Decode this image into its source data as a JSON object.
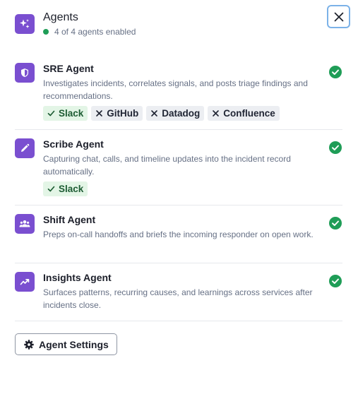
{
  "header": {
    "title": "Agents",
    "status": "4 of 4 agents enabled",
    "icon": "sparkles-icon"
  },
  "colors": {
    "accent": "#7a4fd0",
    "enabled_green": "#1f9d57",
    "tag_on_bg": "#e3f5e6",
    "tag_off_bg": "#eceef2",
    "focus_ring": "#7cb2e8"
  },
  "agents": [
    {
      "name": "SRE Agent",
      "icon": "shield-icon",
      "description": "Investigates incidents, correlates signals, and posts triage findings and recommendations.",
      "enabled": true,
      "integrations": [
        {
          "label": "Slack",
          "enabled": true
        },
        {
          "label": "GitHub",
          "enabled": false
        },
        {
          "label": "Datadog",
          "enabled": false
        },
        {
          "label": "Confluence",
          "enabled": false
        }
      ]
    },
    {
      "name": "Scribe Agent",
      "icon": "pencil-icon",
      "description": "Capturing chat, calls, and timeline updates into the incident record automatically.",
      "enabled": true,
      "integrations": [
        {
          "label": "Slack",
          "enabled": true
        }
      ]
    },
    {
      "name": "Shift Agent",
      "icon": "people-icon",
      "description": "Preps on-call handoffs and briefs the incoming responder on open work.",
      "enabled": true,
      "integrations": []
    },
    {
      "name": "Insights Agent",
      "icon": "trend-icon",
      "description": "Surfaces patterns, recurring causes, and learnings across services after incidents close.",
      "enabled": true,
      "integrations": []
    }
  ],
  "footer": {
    "settings_label": "Agent Settings",
    "settings_icon": "gear-icon"
  }
}
